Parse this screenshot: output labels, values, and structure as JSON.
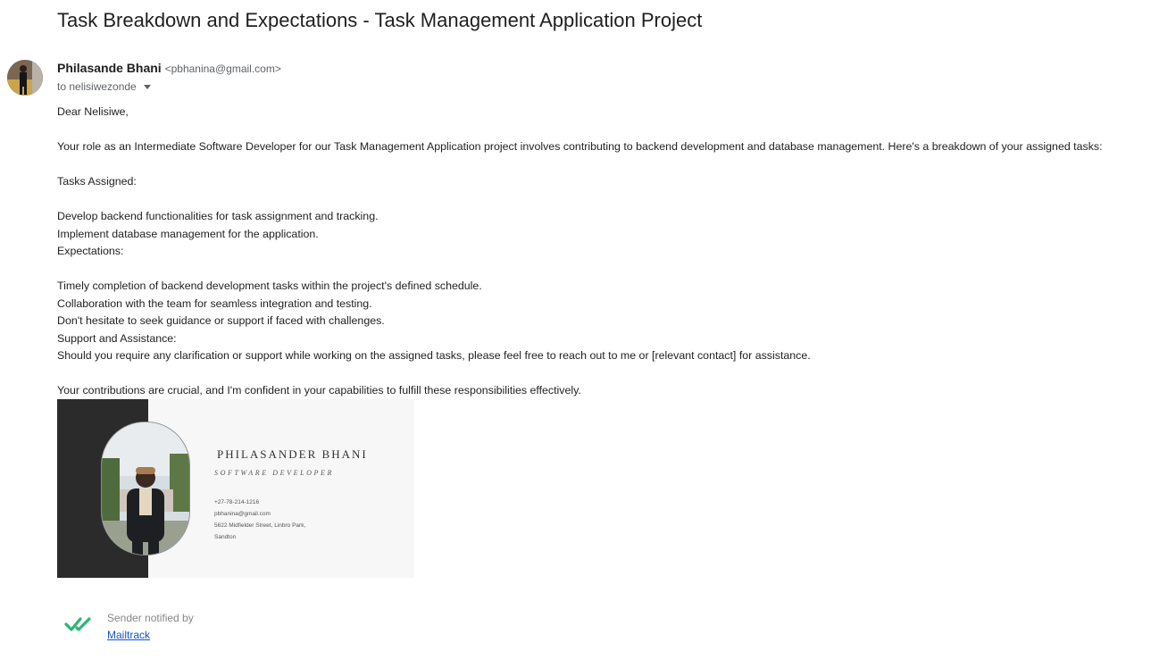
{
  "email": {
    "subject": "Task Breakdown and Expectations - Task Management Application Project",
    "sender_name": "Philasande Bhani",
    "sender_email": "<pbhanina@gmail.com>",
    "to_label": "to nelisiwezonde",
    "body_lines": [
      "Dear Nelisiwe,",
      "",
      "Your role as an Intermediate Software Developer for our Task Management Application project involves contributing to backend development and database management. Here's a breakdown of your assigned tasks:",
      "",
      "Tasks Assigned:",
      "",
      "Develop backend functionalities for task assignment and tracking.",
      "Implement database management for the application.",
      "Expectations:",
      "",
      "Timely completion of backend development tasks within the project's defined schedule.",
      "Collaboration with the team for seamless integration and testing.",
      "Don't hesitate to seek guidance or support if faced with challenges.",
      "Support and Assistance:",
      "Should you require any clarification or support while working on the assigned tasks, please feel free to reach out to me or [relevant contact] for assistance.",
      "",
      "Your contributions are crucial, and I'm confident in your capabilities to fulfill these responsibilities effectively."
    ]
  },
  "signature": {
    "name": "PHILASANDER BHANI",
    "title": "SOFTWARE DEVELOPER",
    "phone": "+27-78-214-1216",
    "email": "pbhanina@gmail.com",
    "address_line1": "5622 Midfielder Street, Linbro Park,",
    "address_line2": "Sandton"
  },
  "mailtrack": {
    "notice": "Sender notified by",
    "link_label": "Mailtrack",
    "icon_name": "double-check-icon",
    "icon_color": "#2bb673"
  },
  "colors": {
    "subject": "#1f1f1f",
    "meta": "#5f6368",
    "link": "#1155cc",
    "signature_dark": "#2b2b2b"
  }
}
